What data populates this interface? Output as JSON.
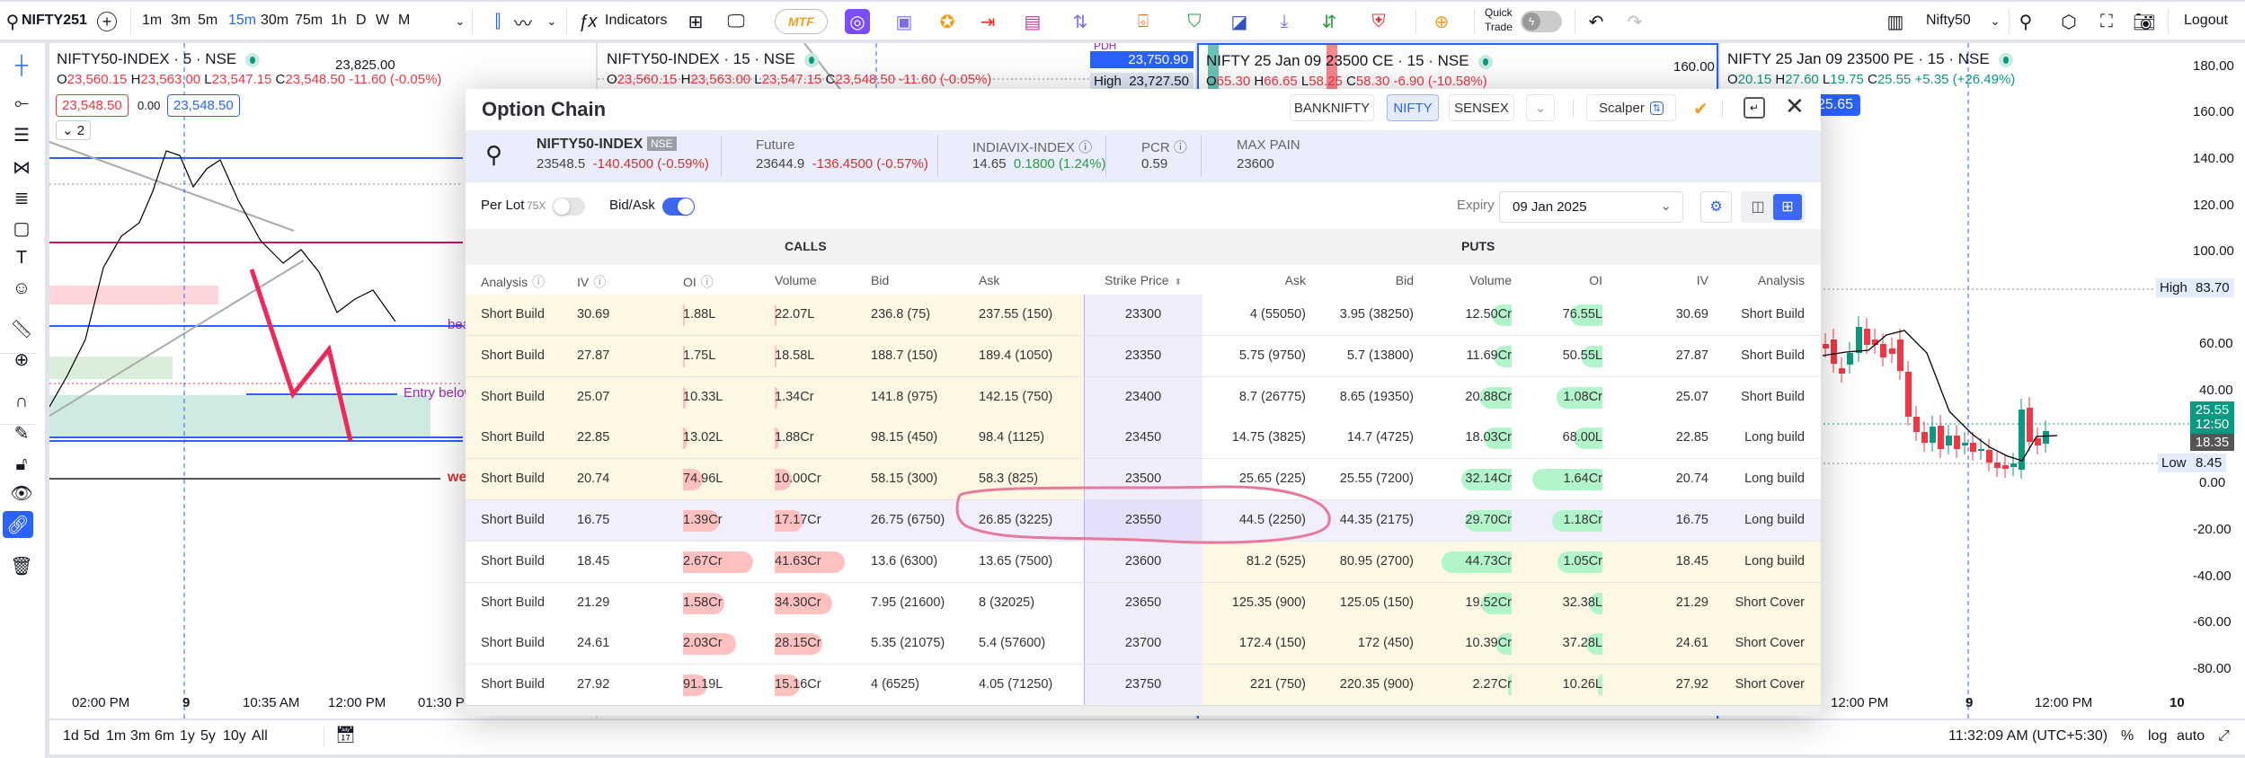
{
  "toolbar": {
    "symbol": "NIFTY251",
    "timeframes": [
      "1m",
      "3m",
      "5m",
      "15m",
      "30m",
      "75m",
      "1h",
      "D",
      "W",
      "M"
    ],
    "active_timeframe": "15m",
    "indicators_label": "Indicators",
    "mtf_label": "MTF",
    "quick_trade_label_1": "Quick",
    "quick_trade_label_2": "Trade",
    "watchlist": "Nifty50",
    "logout_label": "Logout"
  },
  "panes": [
    {
      "title": "NIFTY50-INDEX · 5 · NSE",
      "o": "23,560.15",
      "h": "23,563.00",
      "l": "23,547.15",
      "c": "23,548.50",
      "chg": "-11.60 (-0.05%)",
      "bid_box": "23,548.50",
      "spread": "0.00",
      "ask_box": "23,548.50",
      "indicator_count": "2",
      "axis_top": "23,825.00",
      "time_labels": [
        "02:00 PM",
        "9",
        "10:35 AM",
        "12:00 PM",
        "01:30 PM"
      ],
      "drawing_labels": [
        "bea",
        "Entry below",
        "we"
      ]
    },
    {
      "title": "NIFTY50-INDEX · 15 · NSE",
      "o": "23,560.15",
      "h": "23,563.00",
      "l": "23,547.15",
      "c": "23,548.50",
      "chg": "-11.60 (-0.05%)",
      "pdh_label": "PDH",
      "pdh_value": "23,750.90",
      "high_label": "High",
      "high_value": "23,727.50"
    },
    {
      "title": "NIFTY 25 Jan 09 23500 CE · 15 · NSE",
      "o": "65.30",
      "h": "66.65",
      "l": "58.25",
      "c": "58.30",
      "chg": "-6.90 (-10.58%)",
      "axis_top": "160.00"
    },
    {
      "title": "NIFTY 25 Jan 09 23500 PE · 15 · NSE",
      "o": "20.15",
      "h": "27.60",
      "l": "19.75",
      "c": "25.55",
      "chg": "+5.35 (+26.49%)",
      "price_box": "25.65",
      "axis": [
        "180.00",
        "160.00",
        "140.00",
        "120.00",
        "100.00",
        "60.00",
        "40.00",
        "0.00",
        "-20.00",
        "-40.00",
        "-60.00",
        "-80.00"
      ],
      "high_label": "High",
      "high_value": "83.70",
      "low_label": "Low",
      "low_value": "8.45",
      "last_price": "25.55",
      "countdown": "12:50",
      "ma_value": "18.35",
      "time_labels": [
        "12:00 PM",
        "9",
        "12:00 PM",
        "10"
      ]
    }
  ],
  "bottombar": {
    "ranges": [
      "1d",
      "5d",
      "1m",
      "3m",
      "6m",
      "1y",
      "5y",
      "10y",
      "All"
    ],
    "clock": "11:32:09 AM (UTC+5:30)",
    "percent": "%",
    "log": "log",
    "auto": "auto"
  },
  "option_chain": {
    "title": "Option Chain",
    "indices": [
      "BANKNIFTY",
      "NIFTY",
      "SENSEX"
    ],
    "active_index": "NIFTY",
    "scalper_label": "Scalper",
    "spot": {
      "name": "NIFTY50-INDEX",
      "exchange": "NSE",
      "ltp": "23548.5",
      "change": "-140.4500 (-0.59%)"
    },
    "future": {
      "label": "Future",
      "ltp": "23644.9",
      "change": "-136.4500 (-0.57%)"
    },
    "vix": {
      "label": "INDIAVIX-INDEX",
      "ltp": "14.65",
      "change": "0.1800 (1.24%)"
    },
    "pcr": {
      "label": "PCR",
      "value": "0.59"
    },
    "max_pain": {
      "label": "MAX PAIN",
      "value": "23600"
    },
    "per_lot_label": "Per Lot",
    "lot_size": "75X",
    "per_lot_on": false,
    "bid_ask_label": "Bid/Ask",
    "bid_ask_on": true,
    "expiry_label": "Expiry",
    "expiry_value": "09 Jan 2025",
    "calls_label": "CALLS",
    "puts_label": "PUTS",
    "call_headers": [
      "Analysis",
      "IV",
      "OI",
      "Volume",
      "Bid",
      "Ask"
    ],
    "strike_header": "Strike Price",
    "put_headers": [
      "Ask",
      "Bid",
      "Volume",
      "OI",
      "IV",
      "Analysis"
    ],
    "atm_strike": "23550",
    "colors": {
      "itm": "#fef7e4",
      "atm": "#f1effd",
      "strike": "#f0eefc",
      "call_bar": "#ffc0c0",
      "put_bar": "#b3f5cb",
      "annotation": "#e8799b"
    },
    "rows": [
      {
        "strike": "23300",
        "c": [
          "Short Build",
          "30.69",
          "1.88L",
          "22.07L",
          "236.8 (75)",
          "237.55 (150)"
        ],
        "p": [
          "4 (55050)",
          "3.95 (38250)",
          "12.50Cr",
          "76.55L",
          "30.69",
          "Short Build"
        ]
      },
      {
        "strike": "23350",
        "c": [
          "Short Build",
          "27.87",
          "1.75L",
          "18.58L",
          "188.7 (150)",
          "189.4 (1050)"
        ],
        "p": [
          "5.75 (9750)",
          "5.7 (13800)",
          "11.69Cr",
          "50.55L",
          "27.87",
          "Short Build"
        ]
      },
      {
        "strike": "23400",
        "c": [
          "Short Build",
          "25.07",
          "10.33L",
          "1.34Cr",
          "141.8 (975)",
          "142.15 (750)"
        ],
        "p": [
          "8.7 (26775)",
          "8.65 (19350)",
          "20.88Cr",
          "1.08Cr",
          "25.07",
          "Short Build"
        ]
      },
      {
        "strike": "23450",
        "c": [
          "Short Build",
          "22.85",
          "13.02L",
          "1.88Cr",
          "98.15 (450)",
          "98.4 (1125)"
        ],
        "p": [
          "14.75 (3825)",
          "14.7 (4725)",
          "18.03Cr",
          "68.00L",
          "22.85",
          "Long build"
        ]
      },
      {
        "strike": "23500",
        "c": [
          "Short Build",
          "20.74",
          "74.96L",
          "10.00Cr",
          "58.15 (300)",
          "58.3 (825)"
        ],
        "p": [
          "25.65 (225)",
          "25.55 (7200)",
          "32.14Cr",
          "1.64Cr",
          "20.74",
          "Long build"
        ]
      },
      {
        "strike": "23550",
        "c": [
          "Short Build",
          "16.75",
          "1.39Cr",
          "17.17Cr",
          "26.75 (6750)",
          "26.85 (3225)"
        ],
        "p": [
          "44.5 (2250)",
          "44.35 (2175)",
          "29.70Cr",
          "1.18Cr",
          "16.75",
          "Long build"
        ]
      },
      {
        "strike": "23600",
        "c": [
          "Short Build",
          "18.45",
          "2.67Cr",
          "41.63Cr",
          "13.6 (6300)",
          "13.65 (7500)"
        ],
        "p": [
          "81.2 (525)",
          "80.95 (2700)",
          "44.73Cr",
          "1.05Cr",
          "18.45",
          "Long build"
        ]
      },
      {
        "strike": "23650",
        "c": [
          "Short Build",
          "21.29",
          "1.58Cr",
          "34.30Cr",
          "7.95 (21600)",
          "8 (32025)"
        ],
        "p": [
          "125.35 (900)",
          "125.05 (150)",
          "19.52Cr",
          "32.38L",
          "21.29",
          "Short Cover"
        ]
      },
      {
        "strike": "23700",
        "c": [
          "Short Build",
          "24.61",
          "2.03Cr",
          "28.15Cr",
          "5.35 (21075)",
          "5.4 (57600)"
        ],
        "p": [
          "172.4 (150)",
          "172 (450)",
          "10.39Cr",
          "37.28L",
          "24.61",
          "Short Cover"
        ]
      },
      {
        "strike": "23750",
        "c": [
          "Short Build",
          "27.92",
          "91.19L",
          "15.16Cr",
          "4 (6525)",
          "4.05 (71250)"
        ],
        "p": [
          "221 (750)",
          "220.35 (900)",
          "2.27Cr",
          "10.26L",
          "27.92",
          "Short Cover"
        ]
      }
    ]
  }
}
